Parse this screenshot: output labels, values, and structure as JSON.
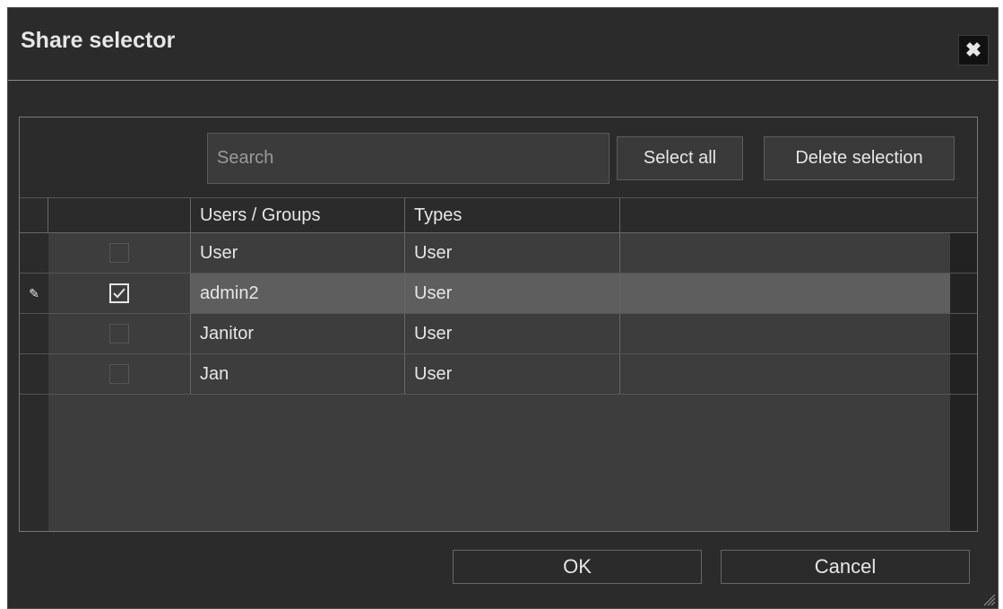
{
  "dialog": {
    "title": "Share selector",
    "close_icon": "close-icon"
  },
  "toolbar": {
    "search_placeholder": "Search",
    "select_all_label": "Select all",
    "delete_selection_label": "Delete selection"
  },
  "table": {
    "columns": [
      "Users / Groups",
      "Types"
    ],
    "rows": [
      {
        "name": "User",
        "type": "User",
        "checked": false,
        "selected": false
      },
      {
        "name": "admin2",
        "type": "User",
        "checked": true,
        "selected": true
      },
      {
        "name": "Janitor",
        "type": "User",
        "checked": false,
        "selected": false
      },
      {
        "name": "Jan",
        "type": "User",
        "checked": false,
        "selected": false
      }
    ]
  },
  "footer": {
    "ok_label": "OK",
    "cancel_label": "Cancel"
  },
  "colors": {
    "background": "#2b2b2b",
    "row": "#3d3d3d",
    "selected_row": "#5e5e5e",
    "text": "#e6e6e6"
  }
}
